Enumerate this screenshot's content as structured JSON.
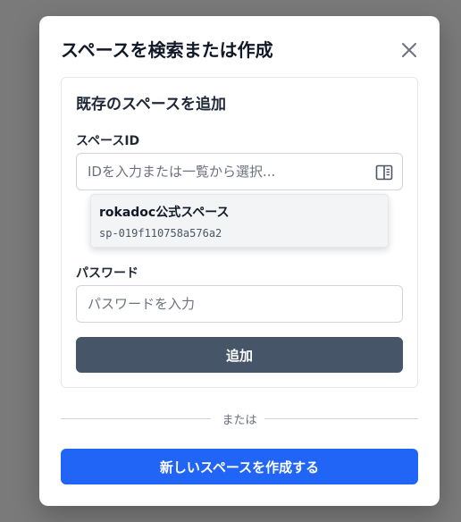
{
  "modal": {
    "title": "スペースを検索または作成",
    "close_icon": "close-icon"
  },
  "existing_space": {
    "title": "既存のスペースを追加",
    "space_id": {
      "label": "スペースID",
      "placeholder": "IDを入力または一覧から選択...",
      "value": "",
      "list_icon": "book-list-icon"
    },
    "dropdown": {
      "items": [
        {
          "name": "rokadoc公式スペース",
          "id": "sp-019f110758a576a2"
        }
      ]
    },
    "password": {
      "label": "パスワード",
      "placeholder": "パスワードを入力",
      "value": ""
    },
    "add_label": "追加"
  },
  "divider_text": "または",
  "create_label": "新しいスペースを作成する",
  "colors": {
    "primary": "#2065f5",
    "secondary_button": "#475569",
    "overlay": "#7a7a7a"
  }
}
